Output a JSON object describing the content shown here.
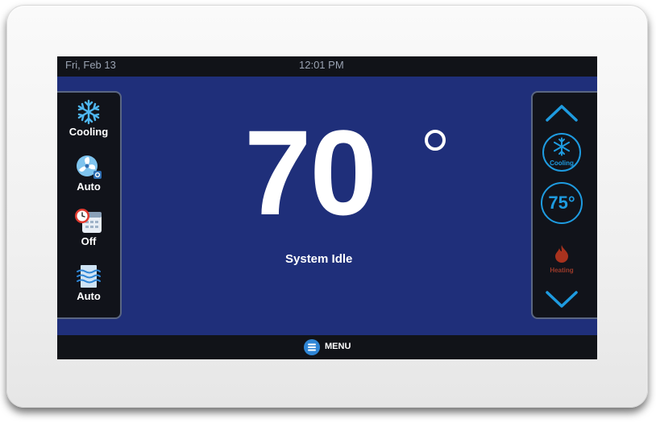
{
  "status_bar": {
    "date": "Fri, Feb 13",
    "time": "12:01 PM"
  },
  "left_panel": {
    "system_mode": {
      "label": "Cooling",
      "icon": "snowflake-icon"
    },
    "fan_mode": {
      "label": "Auto",
      "icon": "fan-icon"
    },
    "schedule": {
      "label": "Off",
      "icon": "schedule-clock-icon"
    },
    "humidity": {
      "label": "Auto",
      "icon": "humidity-icon"
    }
  },
  "main": {
    "current_temp": "70",
    "status": "System Idle"
  },
  "right_panel": {
    "cooling_setpoint_label": "Cooling",
    "setpoint": "75°",
    "heating_label": "Heating"
  },
  "menu": {
    "label": "MENU"
  },
  "colors": {
    "screen_bg": "#1f2f7a",
    "panel_bg": "#11131a",
    "accent_blue": "#1e9be0",
    "heat_red": "#9c3a2a"
  }
}
